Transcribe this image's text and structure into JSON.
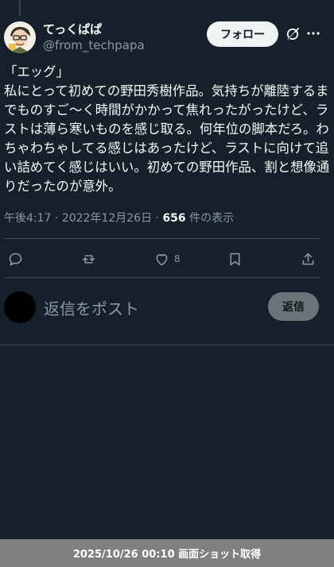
{
  "author": {
    "display_name": "てっくぱぱ",
    "handle": "@from_techpapa"
  },
  "header": {
    "follow_label": "フォロー",
    "icons": [
      "grok-icon",
      "more-icon"
    ]
  },
  "tweet": {
    "text": "「エッグ」\n私にとって初めての野田秀樹作品。気持ちが離陸するまでものすご〜く時間がかかって焦れったがったけど、ラストは薄ら寒いものを感じ取る。何年位の脚本だろ。わちゃわちゃしてる感じはあったけど、ラストに向けて追い詰めてく感じはいい。初めての野田作品、割と想像通りだったのが意外。",
    "time": "午後4:17",
    "separator": " · ",
    "date": "2022年12月26日",
    "views_count": "656",
    "views_label": " 件の表示"
  },
  "actions": {
    "like_count": "8",
    "icons": [
      "reply-icon",
      "repost-icon",
      "like-icon",
      "bookmark-icon",
      "share-icon"
    ]
  },
  "reply": {
    "placeholder": "返信をポスト",
    "button_label": "返信"
  },
  "caption": "2025/10/26 00:10 画面ショット取得",
  "colors": {
    "background": "#15202b",
    "text": "#f7f9f9",
    "muted": "#8b98a5",
    "divider": "#38444d",
    "follow_bg": "#eff3f4",
    "reply_btn_bg": "#6b7479",
    "caption_bg": "#808080"
  }
}
